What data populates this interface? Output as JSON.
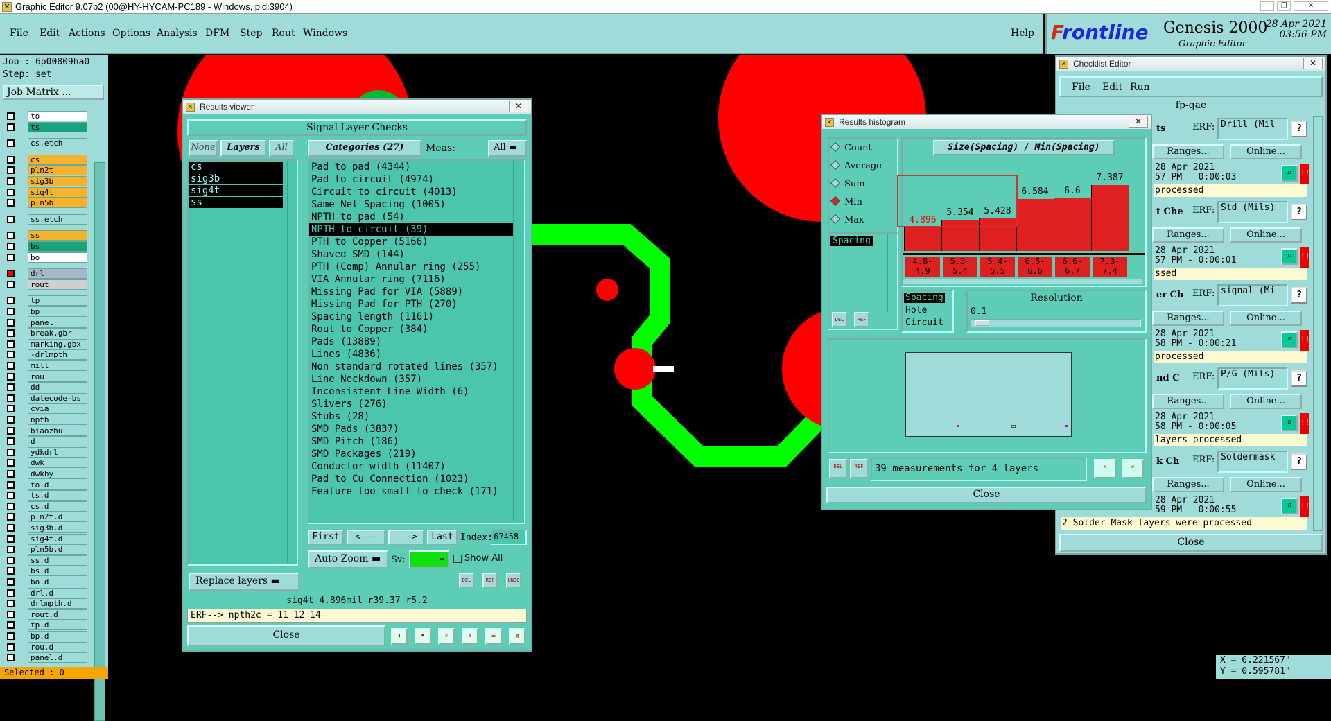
{
  "app": {
    "window_title": "Graphic Editor 9.07b2 (00@HY-HYCAM-PC189 - Windows, pid:3904)",
    "menus": [
      "File",
      "Edit",
      "Actions",
      "Options",
      "Analysis",
      "DFM",
      "Step",
      "Rout",
      "Windows"
    ],
    "help": "Help",
    "logo": {
      "brand_f": "F",
      "brand_rest": "rontline",
      "product": "Genesis 2000",
      "subtitle": "Graphic Editor",
      "date": "28 Apr 2021",
      "time": "03:56 PM"
    }
  },
  "left_panel": {
    "job": "Job : 6p00809ha0",
    "step": "Step: set",
    "job_matrix": "Job Matrix ...",
    "layers": [
      {
        "name": "to",
        "color": "#ffffff",
        "checked": false
      },
      {
        "name": "ts",
        "color": "#18a37c",
        "checked": false
      },
      {
        "name": "cs.etch",
        "color": "#9fdcd9",
        "checked": false
      },
      {
        "name": "cs",
        "color": "#f5b32c",
        "checked": false
      },
      {
        "name": "pln2t",
        "color": "#f5b32c",
        "checked": false
      },
      {
        "name": "sig3b",
        "color": "#f5b32c",
        "checked": false
      },
      {
        "name": "sig4t",
        "color": "#f5b32c",
        "checked": false
      },
      {
        "name": "pln5b",
        "color": "#f5b32c",
        "checked": false
      },
      {
        "name": "ss.etch",
        "color": "#9fdcd9",
        "checked": false
      },
      {
        "name": "ss",
        "color": "#f5b32c",
        "checked": false
      },
      {
        "name": "bs",
        "color": "#18a37c",
        "checked": false
      },
      {
        "name": "bo",
        "color": "#ffffff",
        "checked": false
      },
      {
        "name": "drl",
        "color": "#a8b8c8",
        "checked": true
      },
      {
        "name": "rout",
        "color": "#cfcfcf",
        "checked": false
      },
      {
        "name": "tp",
        "color": "#9fdcd9",
        "checked": false
      },
      {
        "name": "bp",
        "color": "#9fdcd9",
        "checked": false
      },
      {
        "name": "panel",
        "color": "#9fdcd9",
        "checked": false
      },
      {
        "name": "break.gbr",
        "color": "#9fdcd9",
        "checked": false
      },
      {
        "name": "marking.gbx",
        "color": "#9fdcd9",
        "checked": false
      },
      {
        "name": "-drlmpth",
        "color": "#9fdcd9",
        "checked": false
      },
      {
        "name": "mill",
        "color": "#9fdcd9",
        "checked": false
      },
      {
        "name": "rou",
        "color": "#9fdcd9",
        "checked": false
      },
      {
        "name": "dd",
        "color": "#9fdcd9",
        "checked": false
      },
      {
        "name": "datecode-bs",
        "color": "#9fdcd9",
        "checked": false
      },
      {
        "name": "cvia",
        "color": "#9fdcd9",
        "checked": false
      },
      {
        "name": "npth",
        "color": "#9fdcd9",
        "checked": false
      },
      {
        "name": "biaozhu",
        "color": "#9fdcd9",
        "checked": false
      },
      {
        "name": "d",
        "color": "#9fdcd9",
        "checked": false
      },
      {
        "name": "ydkdrl",
        "color": "#9fdcd9",
        "checked": false
      },
      {
        "name": "dwk",
        "color": "#9fdcd9",
        "checked": false
      },
      {
        "name": "dwkby",
        "color": "#9fdcd9",
        "checked": false
      },
      {
        "name": "to.d",
        "color": "#9fdcd9",
        "checked": false
      },
      {
        "name": "ts.d",
        "color": "#9fdcd9",
        "checked": false
      },
      {
        "name": "cs.d",
        "color": "#9fdcd9",
        "checked": false
      },
      {
        "name": "pln2t.d",
        "color": "#9fdcd9",
        "checked": false
      },
      {
        "name": "sig3b.d",
        "color": "#9fdcd9",
        "checked": false
      },
      {
        "name": "sig4t.d",
        "color": "#9fdcd9",
        "checked": false
      },
      {
        "name": "pln5b.d",
        "color": "#9fdcd9",
        "checked": false
      },
      {
        "name": "ss.d",
        "color": "#9fdcd9",
        "checked": false
      },
      {
        "name": "bs.d",
        "color": "#9fdcd9",
        "checked": false
      },
      {
        "name": "bo.d",
        "color": "#9fdcd9",
        "checked": false
      },
      {
        "name": "drl.d",
        "color": "#9fdcd9",
        "checked": false
      },
      {
        "name": "drlmpth.d",
        "color": "#9fdcd9",
        "checked": false
      },
      {
        "name": "rout.d",
        "color": "#9fdcd9",
        "checked": false
      },
      {
        "name": "tp.d",
        "color": "#9fdcd9",
        "checked": false
      },
      {
        "name": "bp.d",
        "color": "#9fdcd9",
        "checked": false
      },
      {
        "name": "rou.d",
        "color": "#9fdcd9",
        "checked": false
      },
      {
        "name": "panel.d",
        "color": "#9fdcd9",
        "checked": false
      }
    ],
    "selected": "Selected : 0"
  },
  "coords": {
    "x": "X = 6.221567\"",
    "y": "Y = 0.595781\""
  },
  "results_viewer": {
    "title": "Results viewer",
    "header": "Signal Layer Checks",
    "none": "None",
    "layers_btn": "Layers",
    "all": "All",
    "categories_label": "Categories (27)",
    "meas_label": "Meas:",
    "meas_value": "All",
    "layers": [
      "cs",
      "sig3b",
      "sig4t",
      "ss"
    ],
    "categories": [
      "Pad to pad (4344)",
      "Pad to circuit (4974)",
      "Circuit to circuit (4013)",
      "Same Net Spacing (1005)",
      "NPTH to pad (54)",
      "NPTH to circuit (39)",
      "PTH to Copper (5166)",
      "Shaved SMD (144)",
      "PTH (Comp) Annular ring (255)",
      "VIA Annular ring (7116)",
      "Missing Pad for VIA (5889)",
      "Missing Pad for PTH (270)",
      "Spacing length (1161)",
      "Rout to Copper (384)",
      "Pads (13889)",
      "Lines (4836)",
      "Non standard rotated lines (357)",
      "Line Neckdown (357)",
      "Inconsistent Line Width (6)",
      "Slivers (276)",
      "Stubs (28)",
      "SMD Pads (3837)",
      "SMD Pitch (186)",
      "SMD Packages (219)",
      "Conductor width (11407)",
      "Pad to Cu Connection (1023)",
      "Feature too small to check (171)"
    ],
    "selected_category": 5,
    "nav": {
      "first": "First",
      "prev": "<---",
      "next": "--->",
      "last": "Last",
      "index_label": "Index:",
      "index_value": "67458"
    },
    "auto_zoom": "Auto Zoom",
    "sv_label": "Sv:",
    "show_all": "Show All",
    "replace_layers": "Replace layers",
    "status": "sig4t 4.896mil  r39.37  r5.2",
    "erf": "ERF--> npth2c = 11 12 14",
    "close": "Close",
    "icons": {
      "del": "DEL",
      "ref": "REF",
      "undo": "UNDO"
    }
  },
  "histogram": {
    "title": "Results histogram",
    "modes": [
      "Count",
      "Average",
      "Sum",
      "Min",
      "Max"
    ],
    "selected_mode": "Min",
    "function_title": "Size(Spacing) / Min(Spacing)",
    "list_item": "Spacing",
    "chart_data": {
      "type": "bar",
      "categories": [
        "4.8-4.9",
        "5.3-5.4",
        "5.4-5.5",
        "6.5-6.6",
        "6.6-6.7",
        "7.3-7.4"
      ],
      "cat_top": [
        "4.8-",
        "5.3-",
        "5.4-",
        "6.5-",
        "6.6-",
        "7.3-"
      ],
      "cat_bottom": [
        "4.9",
        "5.4",
        "5.5",
        "6.6",
        "6.7",
        "7.4"
      ],
      "values": [
        4.896,
        5.354,
        5.428,
        6.584,
        6.6,
        7.387
      ],
      "labels": [
        "4.896",
        "5.354",
        "5.428",
        "6.584",
        "6.6",
        "7.387"
      ],
      "highlight_index": 0
    },
    "types": [
      "Spacing",
      "Hole",
      "Circuit"
    ],
    "resolution_label": "Resolution",
    "resolution_value": "0.1",
    "measurements": "39 measurements for 4 layers",
    "close": "Close",
    "icons": {
      "del": "DEL",
      "ref": "REF"
    }
  },
  "checklist": {
    "title": "Checklist Editor",
    "menus": [
      "File",
      "Edit",
      "Run"
    ],
    "name": "fp-qae",
    "erf_label": "ERF:",
    "ranges": "Ranges...",
    "online": "Online...",
    "close": "Close",
    "rows": [
      {
        "frag": "ts",
        "erf": "Drill (Mil",
        "date": "28 Apr 2021",
        "time": "57 PM - 0:00:03",
        "status": "processed"
      },
      {
        "frag": "t Che",
        "erf": "Std (Mils)",
        "date": "28 Apr 2021",
        "time": "57 PM - 0:00:01",
        "status": "ssed"
      },
      {
        "frag": "er Ch",
        "erf": "signal (Mi",
        "date": "28 Apr 2021",
        "time": "58 PM - 0:00:21",
        "status": "processed"
      },
      {
        "frag": "nd C",
        "erf": "P/G (Mils)",
        "date": "28 Apr 2021",
        "time": "58 PM - 0:00:05",
        "status": "layers processed"
      },
      {
        "frag": "k Ch",
        "erf": "Soldermask",
        "date": "28 Apr 2021",
        "time": "59 PM - 0:00:55",
        "status": "2 Solder Mask layers were processed"
      }
    ]
  }
}
